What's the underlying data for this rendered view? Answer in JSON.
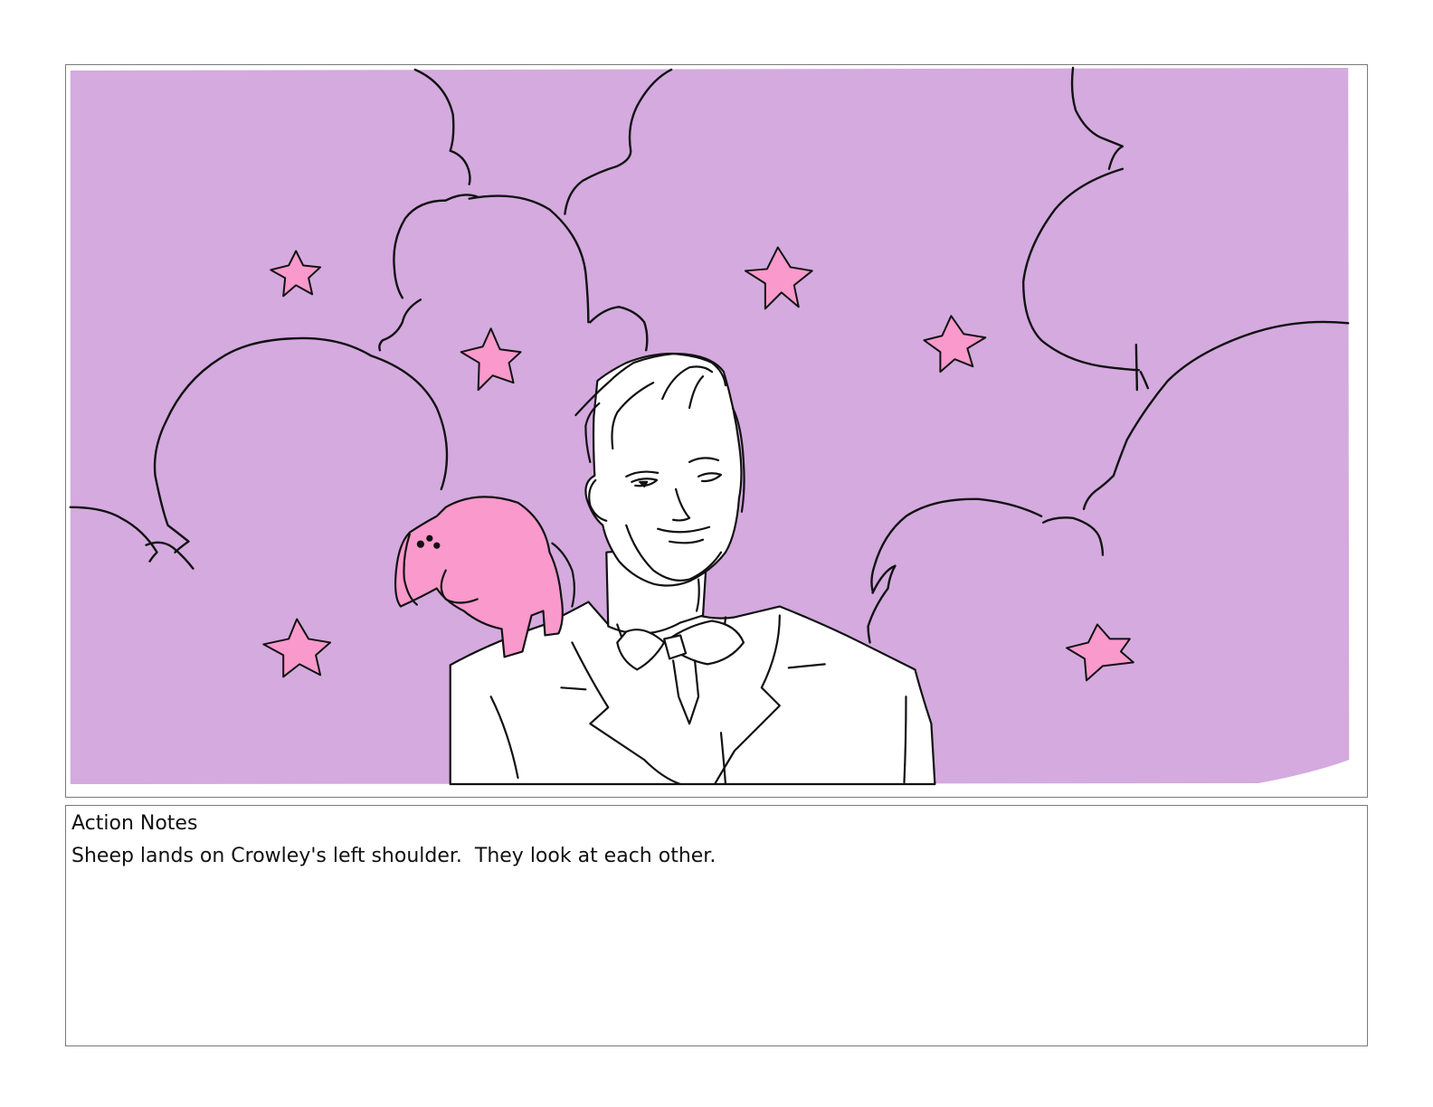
{
  "storyboard": {
    "panel": {
      "background_color": "#d4aadf",
      "accent_color": "#f999cc",
      "line_color": "#111111",
      "icons": [
        "cloud-shapes",
        "star-shapes",
        "sheep-figure",
        "crowley-figure"
      ]
    },
    "notes": {
      "title": "Action Notes",
      "text": "Sheep lands on Crowley's left shoulder.  They look at each other."
    }
  }
}
